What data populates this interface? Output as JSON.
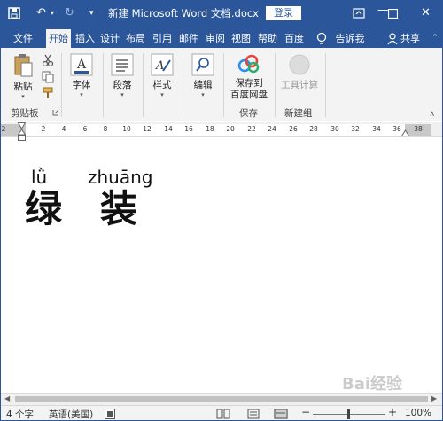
{
  "window": {
    "title": "新建 Microsoft Word 文档.docx",
    "login_label": "登录",
    "colors": {
      "accent": "#2b579a",
      "ribbon_bg": "#f3f3f3"
    }
  },
  "tabs": [
    {
      "label": "文件"
    },
    {
      "label": "开始"
    },
    {
      "label": "插入"
    },
    {
      "label": "设计"
    },
    {
      "label": "布局"
    },
    {
      "label": "引用"
    },
    {
      "label": "邮件"
    },
    {
      "label": "审阅"
    },
    {
      "label": "视图"
    },
    {
      "label": "帮助"
    },
    {
      "label": "百度"
    }
  ],
  "tell_me": "告诉我",
  "share": "共享",
  "ribbon": {
    "paste": "粘贴",
    "clipboard_group": "剪贴板",
    "font": "字体",
    "paragraph": "段落",
    "styles": "样式",
    "editing": "编辑",
    "save_to_baidu": "保存到",
    "save_to_baidu_2": "百度网盘",
    "save_group": "保存",
    "tool_calc": "工具计算",
    "new_group": "新建组"
  },
  "ruler_ticks": [
    "2",
    "2",
    "4",
    "6",
    "8",
    "10",
    "12",
    "14",
    "16",
    "18",
    "20",
    "22",
    "24",
    "26",
    "28",
    "30",
    "32",
    "34",
    "36",
    "38"
  ],
  "document": {
    "pinyin_1": "lǜ",
    "pinyin_2": "zhuāng",
    "hanzi_1": "绿",
    "hanzi_2": "装"
  },
  "status": {
    "word_count": "4 个字",
    "language": "英语(美国)",
    "zoom": "100%",
    "zoom_minus": "−",
    "zoom_plus": "+"
  },
  "watermark": "Bai经验"
}
